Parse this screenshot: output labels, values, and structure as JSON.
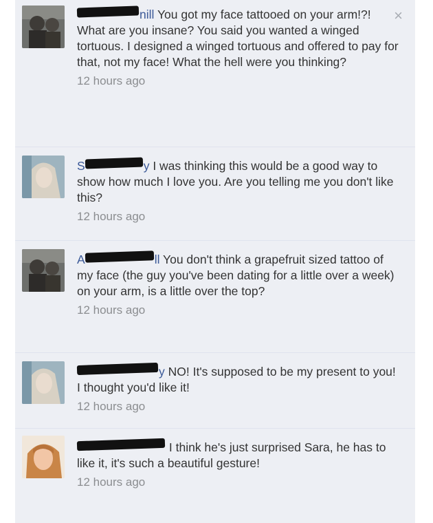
{
  "comments": [
    {
      "author_visible": "nill",
      "text": "You got my face tattooed on your arm!?! What are you insane? You said you wanted a winged tortuous. I designed a winged tortuous and offered to pay for that, not my face! What the hell were you thinking?",
      "time": "12 hours ago",
      "avatar": "male-dark-photo"
    },
    {
      "author_visible": "S",
      "author_tail": "y",
      "text": "I was thinking this would be a good way to show how much I love you. Are you telling me you don't like this?",
      "time": "12 hours ago",
      "avatar": "female-blonde-photo"
    },
    {
      "author_visible": "A",
      "author_tail": "ll",
      "text": "You don't think a grapefruit sized tattoo of my face (the guy you've been dating for a little over a week) on your arm, is a little over the top?",
      "time": "12 hours ago",
      "avatar": "male-dark-photo"
    },
    {
      "author_visible": "",
      "author_tail": "y",
      "text": "NO! It's supposed to be my present to you! I thought you'd like it!",
      "time": "12 hours ago",
      "avatar": "female-blonde-photo"
    },
    {
      "author_visible": "",
      "author_tail": "",
      "text": "I think he's just surprised Sara, he has to like it, it's such a beautiful gesture!",
      "time": "12 hours ago",
      "avatar": "female-redhead-photo"
    }
  ],
  "close_glyph": "×",
  "colors": {
    "link": "#3b5998",
    "timestamp": "#8b8d90",
    "background": "#edeff4"
  }
}
